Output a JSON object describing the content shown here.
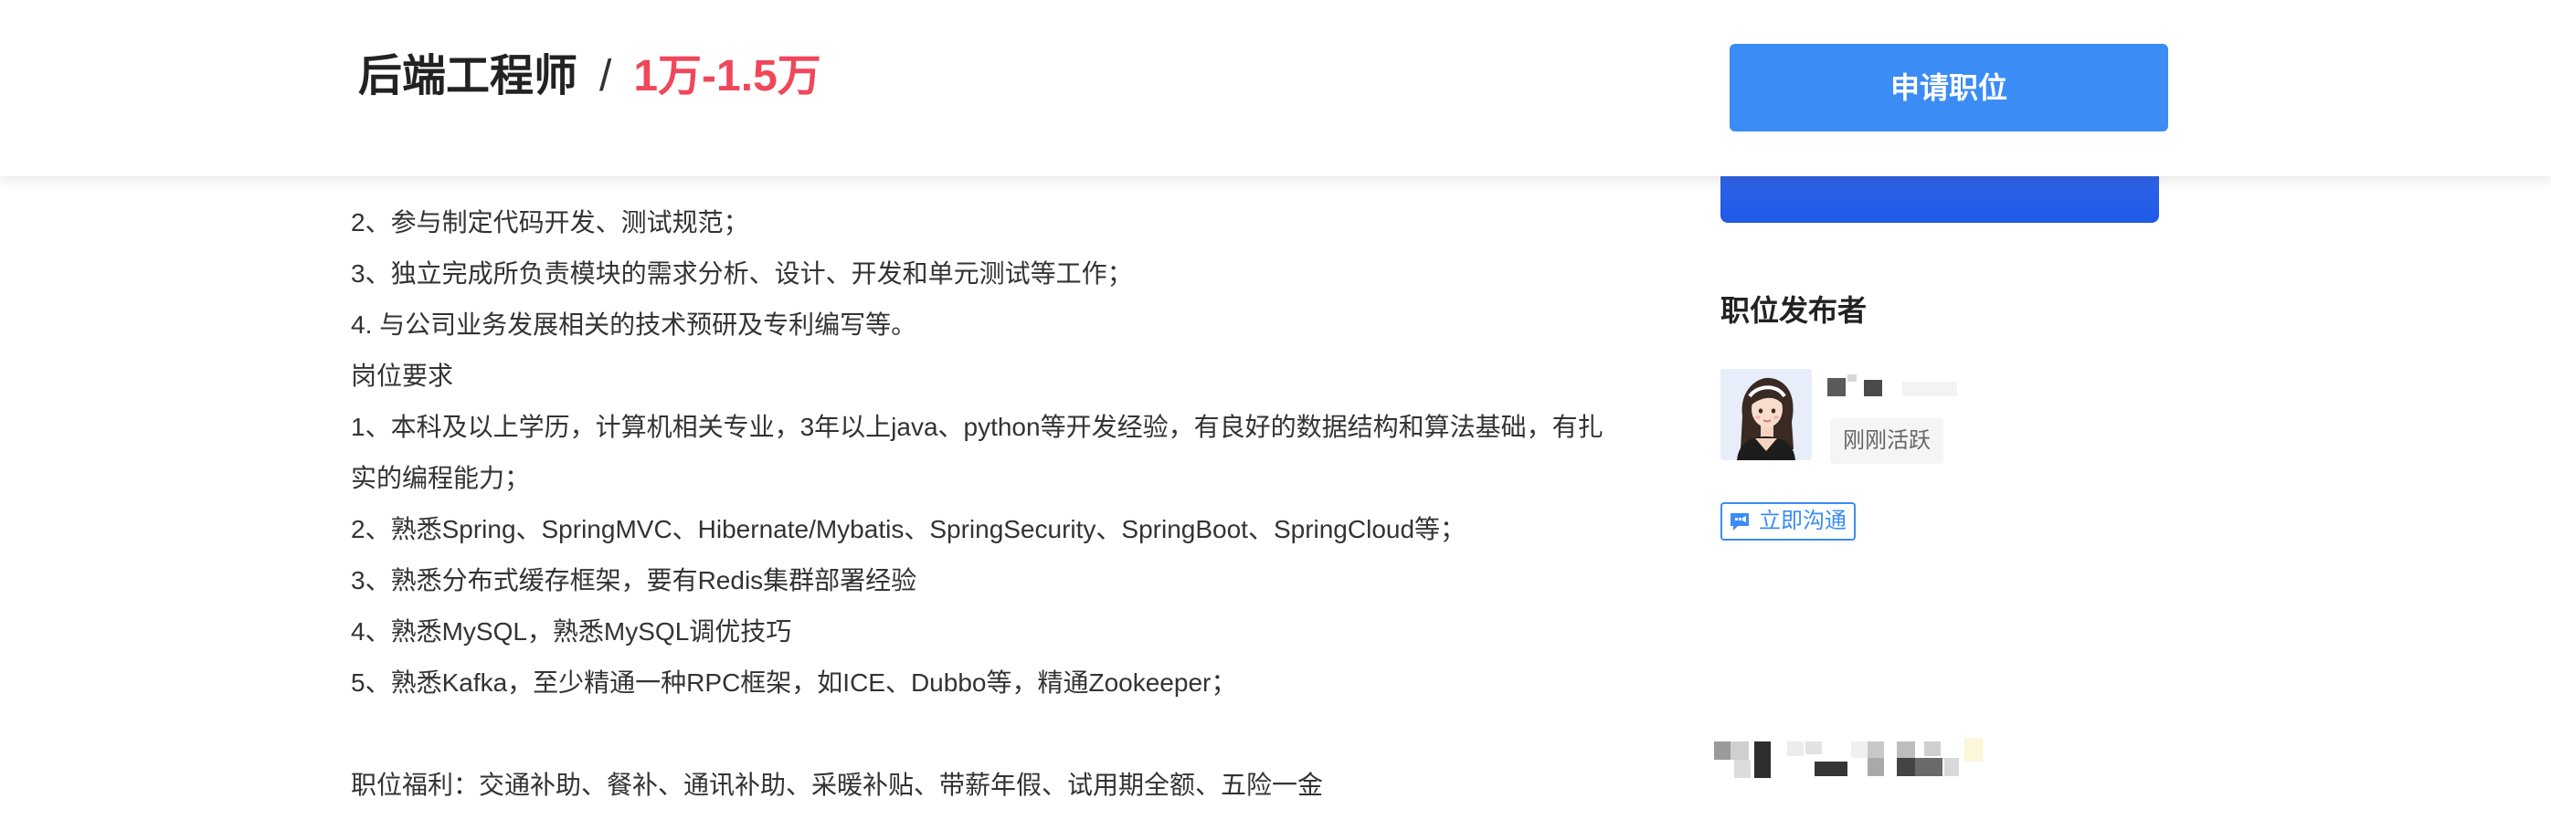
{
  "header": {
    "job_title": "后端工程师",
    "separator": "/",
    "salary": "1万-1.5万",
    "apply_label": "申请职位"
  },
  "description": {
    "duties_tail": [
      "2、参与制定代码开发、测试规范；",
      "3、独立完成所负责模块的需求分析、设计、开发和单元测试等工作；",
      "4. 与公司业务发展相关的技术预研及专利编写等。"
    ],
    "requirements_heading": "岗位要求",
    "requirements": [
      "1、本科及以上学历，计算机相关专业，3年以上java、python等开发经验，有良好的数据结构和算法基础，有扎实的编程能力；",
      "2、熟悉Spring、SpringMVC、Hibernate/Mybatis、SpringSecurity、SpringBoot、SpringCloud等；",
      "3、熟悉分布式缓存框架，要有Redis集群部署经验",
      "4、熟悉MySQL，熟悉MySQL调优技巧",
      "5、熟悉Kafka，至少精通一种RPC框架，如ICE、Dubbo等，精通Zookeeper；"
    ],
    "benefits": "职位福利：交通补助、餐补、通讯补助、采暖补贴、带薪年假、试用期全额、五险一金"
  },
  "publisher": {
    "section_title": "职位发布者",
    "active_status": "刚刚活跃",
    "chat_label": "立即沟通"
  },
  "colors": {
    "primary_blue": "#3b8cf4",
    "salary_red": "#f0475a"
  }
}
